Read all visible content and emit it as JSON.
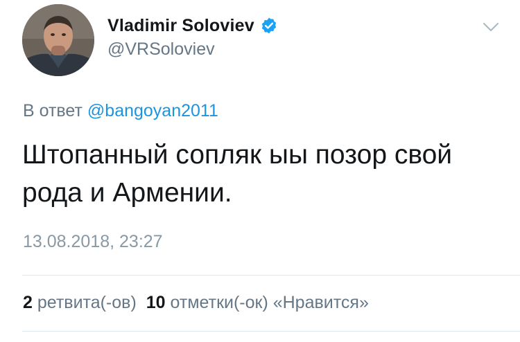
{
  "author": {
    "display_name": "Vladimir Soloviev",
    "handle": "@VRSoloviev",
    "verified": true,
    "verified_color": "#1da1f2"
  },
  "reply": {
    "prefix": "В ответ",
    "mention": "@bangoyan2011"
  },
  "tweet": {
    "text_line1": "Штопанный сопляк ыы позор свой",
    "text_line2": "рода и Армении."
  },
  "timestamp": "13.08.2018, 23:27",
  "stats": {
    "retweets_count": "2",
    "retweets_label": "ретвита(-ов)",
    "likes_count": "10",
    "likes_label": "отметки(-ок) «Нравится»"
  },
  "icons": {
    "menu": "chevron-down-icon",
    "verified": "verified-badge-icon"
  },
  "colors": {
    "text_primary": "#14171a",
    "text_secondary": "#657786",
    "link": "#1b95e0",
    "timestamp": "#8899a6",
    "divider": "#e1e8ed"
  }
}
